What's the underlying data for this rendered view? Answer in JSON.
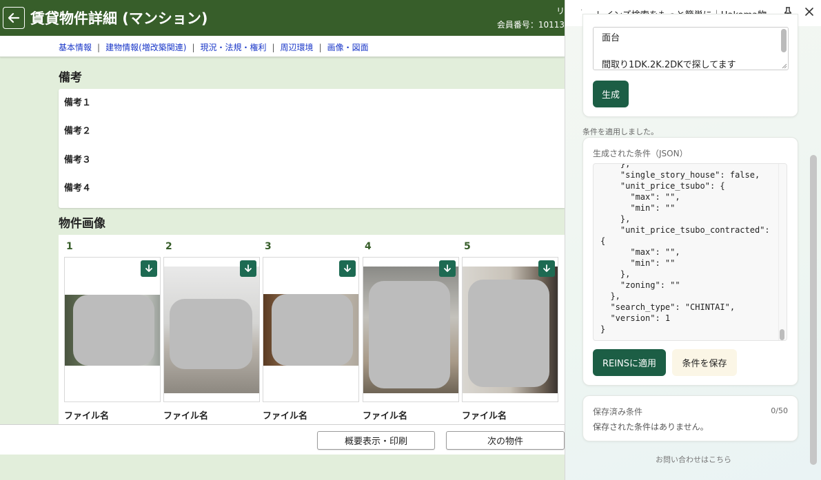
{
  "header": {
    "title": "賃貸物件詳細 (マンション)",
    "member_line1": "リ",
    "member_line2": "会員番号：10113"
  },
  "subnav": {
    "items": [
      "基本情報",
      "建物情報(増改築関連)",
      "現況・法規・権利",
      "周辺環境",
      "画像・図面"
    ],
    "separator": "|"
  },
  "remarks": {
    "heading": "備考",
    "items": [
      "備考１",
      "備考２",
      "備考３",
      "備考４"
    ]
  },
  "images": {
    "heading": "物件画像",
    "filename_label": "ファイル名",
    "items": [
      {
        "num": "1"
      },
      {
        "num": "2"
      },
      {
        "num": "3"
      },
      {
        "num": "4"
      },
      {
        "num": "5"
      }
    ]
  },
  "footer": {
    "summary_print": "概要表示・印刷",
    "next_property": "次の物件"
  },
  "side_panel": {
    "title": "レインズ検索をもっと簡単に｜Hakoma物...",
    "dot": "·",
    "prompt_line1": "面台",
    "prompt_line2": "間取り1DK.2K.2DKで探してます",
    "generate_button": "生成",
    "applied_message": "条件を適用しました。",
    "json_label": "生成された条件（JSON）",
    "json_text": "    },\n    \"single_story_house\": false,\n    \"unit_price_tsubo\": {\n      \"max\": \"\",\n      \"min\": \"\"\n    },\n    \"unit_price_tsubo_contracted\":\n{\n      \"max\": \"\",\n      \"min\": \"\"\n    },\n    \"zoning\": \"\"\n  },\n  \"search_type\": \"CHINTAI\",\n  \"version\": 1\n}",
    "apply_button": "REINSに適用",
    "save_button": "条件を保存",
    "saved_label": "保存済み条件",
    "saved_count": "0/50",
    "saved_empty": "保存された条件はありません。",
    "contact_link": "お問い合わせはこちら"
  },
  "colors": {
    "header_green": "#375e2a",
    "button_green": "#1c5e45",
    "download_green": "#1d6a52",
    "link_blue": "#1a37c8",
    "page_bg": "#e2eedb"
  }
}
